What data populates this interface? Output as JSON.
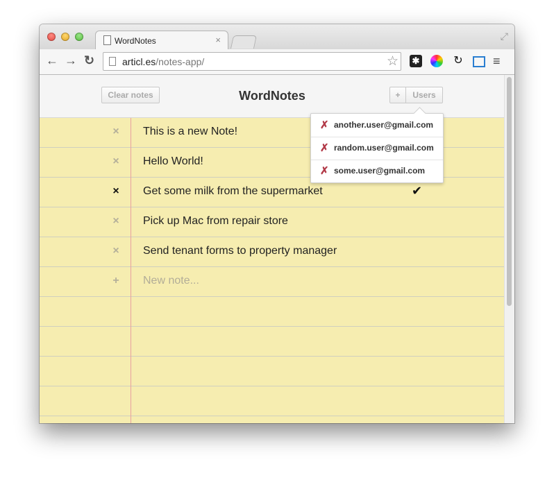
{
  "browser": {
    "tab_title": "WordNotes",
    "tab_close": "×",
    "url_domain": "articl.es",
    "url_path": "/notes-app/",
    "back": "←",
    "forward": "→",
    "reload": "↻",
    "star": "☆",
    "menu": "≡",
    "fullscreen": "⤢"
  },
  "app": {
    "title": "WordNotes",
    "clear_label": "Clear notes",
    "add_user_label": "+",
    "users_label": "Users"
  },
  "notes": [
    {
      "text": "This is a new Note!",
      "icon": "×",
      "done": false
    },
    {
      "text": "Hello World!",
      "icon": "×",
      "done": false
    },
    {
      "text": "Get some milk from the supermarket",
      "icon": "×",
      "done": true,
      "check": "✔"
    },
    {
      "text": "Pick up Mac from repair store",
      "icon": "×",
      "done": false
    },
    {
      "text": "Send tenant forms to property manager",
      "icon": "×",
      "done": false
    }
  ],
  "new_note": {
    "icon": "+",
    "placeholder": "New note..."
  },
  "users_dropdown": [
    {
      "email": "another.user@gmail.com",
      "remove": "✗"
    },
    {
      "email": "random.user@gmail.com",
      "remove": "✗"
    },
    {
      "email": "some.user@gmail.com",
      "remove": "✗"
    }
  ],
  "colors": {
    "paper": "#f6edb0",
    "margin_line": "#e8a0a0",
    "remove_user": "#b23a48"
  }
}
